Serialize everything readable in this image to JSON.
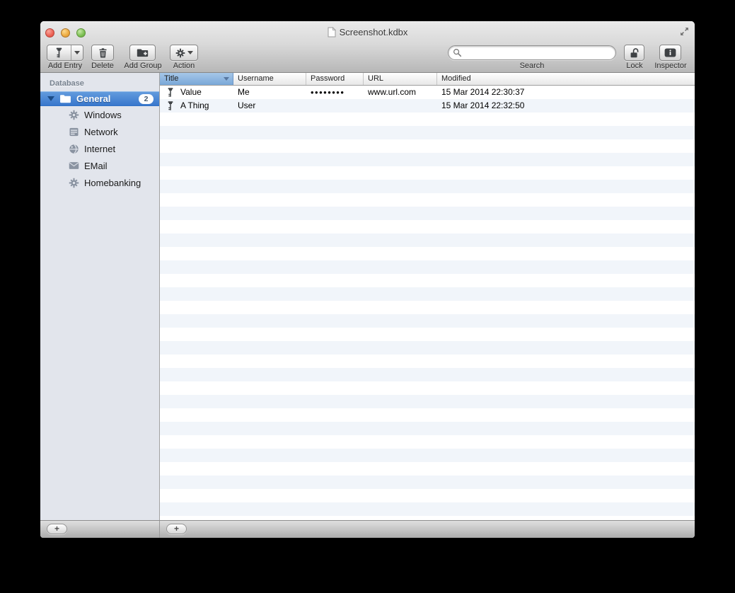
{
  "window": {
    "title": "Screenshot.kdbx"
  },
  "toolbar": {
    "add_entry_label": "Add Entry",
    "delete_label": "Delete",
    "add_group_label": "Add Group",
    "action_label": "Action",
    "search_label": "Search",
    "search_value": "",
    "lock_label": "Lock",
    "inspector_label": "Inspector"
  },
  "sidebar": {
    "header": "Database",
    "group": {
      "label": "General",
      "badge": "2",
      "expanded": true
    },
    "items": [
      {
        "label": "Windows",
        "icon": "gear-icon"
      },
      {
        "label": "Network",
        "icon": "server-icon"
      },
      {
        "label": "Internet",
        "icon": "globe-icon"
      },
      {
        "label": "EMail",
        "icon": "envelope-icon"
      },
      {
        "label": "Homebanking",
        "icon": "gear-icon"
      }
    ],
    "add_button_label": "+"
  },
  "table": {
    "columns": [
      "Title",
      "Username",
      "Password",
      "URL",
      "Modified"
    ],
    "sort": {
      "column": "Title",
      "direction": "descending"
    },
    "rows": [
      {
        "icon": "key-icon",
        "title": "Value",
        "username": "Me",
        "password": "••••••••",
        "url": "www.url.com",
        "modified": "15 Mar 2014 22:30:37"
      },
      {
        "icon": "key-icon",
        "title": "A Thing",
        "username": "User",
        "password": "",
        "url": "",
        "modified": "15 Mar 2014 22:32:50"
      }
    ],
    "add_button_label": "+"
  },
  "icons": {
    "window_controls": [
      "close-icon",
      "minimize-icon",
      "zoom-icon"
    ],
    "title_document": "document-icon",
    "fullscreen": "fullscreen-arrows-icon",
    "add_entry": "key-icon",
    "delete": "trash-icon",
    "add_group": "folder-plus-icon",
    "action": "gear-icon",
    "search": "magnifier-icon",
    "lock": "open-padlock-icon",
    "inspector": "info-icon",
    "group": "folder-icon"
  },
  "colors": {
    "selection_blue_top": "#649dde",
    "selection_blue_bottom": "#2f6fc4",
    "sort_header_top": "#a6c7e8",
    "sort_header_bottom": "#79a7d8",
    "row_stripe": "#f1f5fa",
    "sidebar_bg": "#e2e5ec",
    "sidebar_icon_gray": "#8a93a1"
  }
}
